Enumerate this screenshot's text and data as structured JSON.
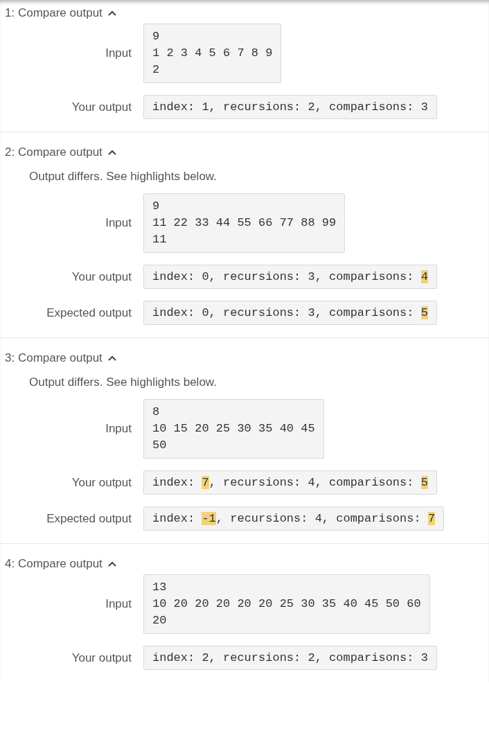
{
  "tests": [
    {
      "title": "1: Compare output",
      "expanded": true,
      "rows": [
        {
          "label": "Input",
          "kind": "input",
          "lines": [
            "9",
            "1 2 3 4 5 6 7 8 9",
            "2"
          ]
        },
        {
          "label": "Your output",
          "kind": "output",
          "segments": [
            {
              "text": "index: 1, recursions: 2, comparisons: 3",
              "highlighted": false
            }
          ]
        }
      ]
    },
    {
      "title": "2: Compare output",
      "expanded": true,
      "message": "Output differs. See highlights below.",
      "rows": [
        {
          "label": "Input",
          "kind": "input",
          "lines": [
            "9",
            "11 22 33 44 55 66 77 88 99",
            "11"
          ]
        },
        {
          "label": "Your output",
          "kind": "output",
          "segments": [
            {
              "text": "index: 0, recursions: 3, comparisons: ",
              "highlighted": false
            },
            {
              "text": "4",
              "highlighted": true
            }
          ]
        },
        {
          "label": "Expected output",
          "kind": "output",
          "segments": [
            {
              "text": "index: 0, recursions: 3, comparisons: ",
              "highlighted": false
            },
            {
              "text": "5",
              "highlighted": true
            }
          ]
        }
      ]
    },
    {
      "title": "3: Compare output",
      "expanded": true,
      "message": "Output differs. See highlights below.",
      "rows": [
        {
          "label": "Input",
          "kind": "input",
          "lines": [
            "8",
            "10 15 20 25 30 35 40 45",
            "50"
          ]
        },
        {
          "label": "Your output",
          "kind": "output",
          "segments": [
            {
              "text": "index: ",
              "highlighted": false
            },
            {
              "text": "7",
              "highlighted": true
            },
            {
              "text": ", recursions: 4, comparisons: ",
              "highlighted": false
            },
            {
              "text": "5",
              "highlighted": true
            }
          ]
        },
        {
          "label": "Expected output",
          "kind": "output",
          "segments": [
            {
              "text": "index: ",
              "highlighted": false
            },
            {
              "text": "-1",
              "highlighted": true
            },
            {
              "text": ", recursions: 4, comparisons: ",
              "highlighted": false
            },
            {
              "text": "7",
              "highlighted": true
            }
          ]
        }
      ]
    },
    {
      "title": "4: Compare output",
      "expanded": true,
      "rows": [
        {
          "label": "Input",
          "kind": "input",
          "lines": [
            "13",
            "10 20 20 20 20 20 25 30 35 40 45 50 60",
            "20"
          ]
        },
        {
          "label": "Your output",
          "kind": "output",
          "segments": [
            {
              "text": "index: 2, recursions: 2, comparisons: 3",
              "highlighted": false
            }
          ]
        }
      ]
    }
  ]
}
